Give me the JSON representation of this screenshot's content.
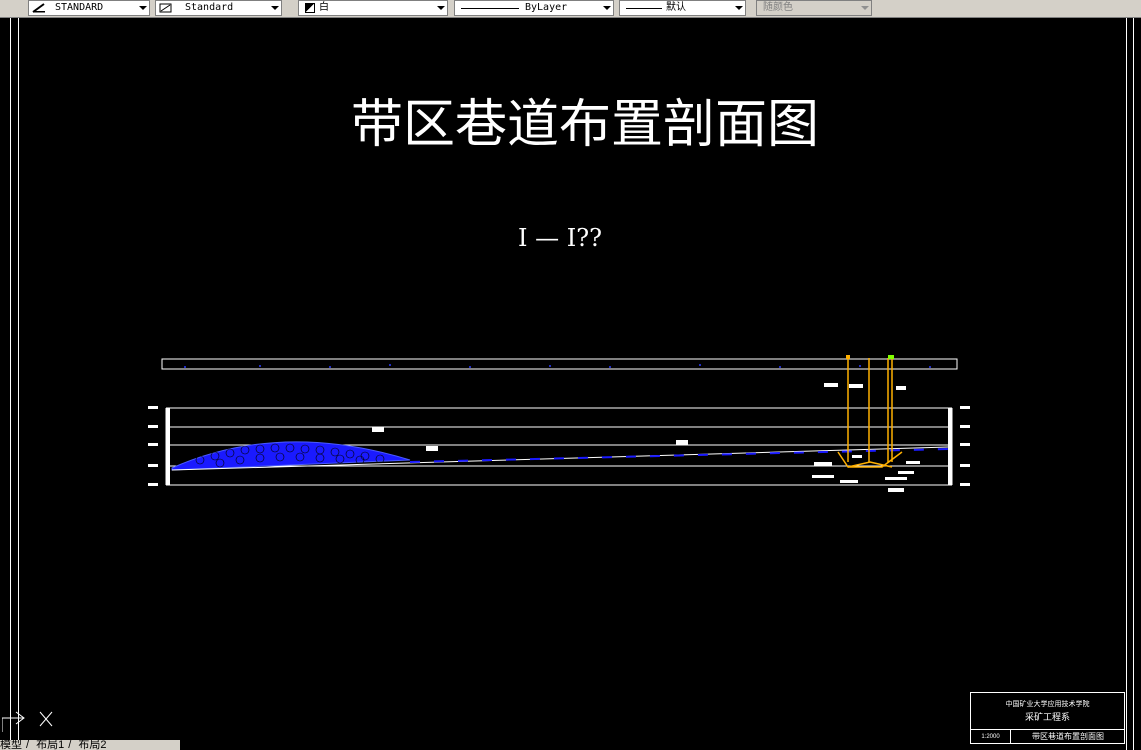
{
  "toolbar": {
    "text_style": "STANDARD",
    "dim_style": "Standard",
    "layer": "白",
    "linetype": "ByLayer",
    "lineweight": "默认",
    "plot_style": "随颜色"
  },
  "drawing": {
    "title": "带区巷道布置剖面图",
    "section_label": "I — I??"
  },
  "title_block": {
    "school": "中国矿业大学应用技术学院",
    "department": "采矿工程系",
    "scale": "1:2000",
    "drawing_name": "带区巷道布置剖面图"
  },
  "layout_tabs": [
    "模型",
    "布局1",
    "布局2"
  ],
  "colors": {
    "background": "#000000",
    "lines": "#ffffff",
    "coal_seam": "#1a1aff",
    "shaft": "#ffb000",
    "shaft_top": "#80ff00"
  }
}
